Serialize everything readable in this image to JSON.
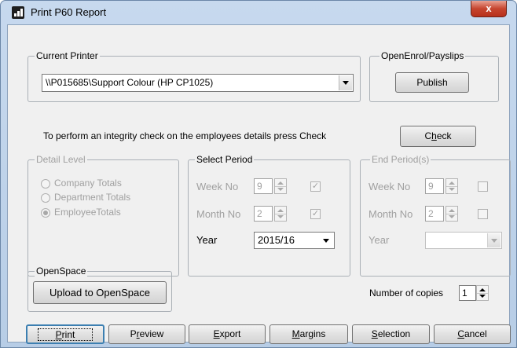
{
  "window": {
    "title": "Print P60 Report",
    "close_label": "x"
  },
  "current_printer": {
    "legend": "Current Printer",
    "value": "\\\\P015685\\Support Colour (HP CP1025)"
  },
  "openenrol": {
    "legend": "OpenEnrol/Payslips",
    "publish_label": "Publish"
  },
  "integrity": {
    "text": "To perform an integrity check on the employees details press Check",
    "check_label": "Check"
  },
  "detail_level": {
    "legend": "Detail Level",
    "options": [
      "Company Totals",
      "Department Totals",
      "EmployeeTotals"
    ],
    "selected": "EmployeeTotals"
  },
  "select_period": {
    "legend": "Select Period",
    "week_label": "Week No",
    "week_value": "9",
    "month_label": "Month No",
    "month_value": "2",
    "year_label": "Year",
    "year_value": "2015/16"
  },
  "end_period": {
    "legend": "End Period(s)",
    "week_label": "Week No",
    "week_value": "9",
    "month_label": "Month No",
    "month_value": "2",
    "year_label": "Year",
    "year_value": ""
  },
  "openspace": {
    "legend": "OpenSpace",
    "upload_label": "Upload to OpenSpace"
  },
  "copies": {
    "label": "Number of copies",
    "value": "1"
  },
  "buttons": {
    "print": "Print",
    "preview": "Preview",
    "export": "Export",
    "margins": "Margins",
    "selection": "Selection",
    "cancel": "Cancel"
  }
}
